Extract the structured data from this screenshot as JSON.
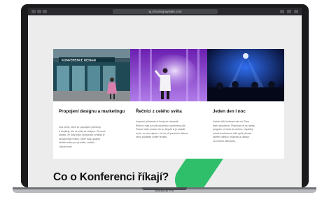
{
  "browser": {
    "url": "ig.choosegraywale.com"
  },
  "cards": [
    {
      "title": "Propojení designu a marketingu",
      "text": [
        "Dva světy, které se navzájem potřebují",
        "a doplňují, ale ne vždy se chápou. Chceme",
        "ukázat, že díky jejich spolupráci vznikají ty",
        "nejúčinnější řešení, které mají uplatnit",
        "skvělé místo pro produkt, značku",
        "i společnost."
      ],
      "image_sign": "KONFERENCE DESIGN"
    },
    {
      "title": "Řečníci z celého světa",
      "text": [
        "Inspirací přinesete si hosty ze zahraničí.",
        "Řečníci mají na své prezentaci vymezený čas.",
        "Potom máte prostor na to, abyste si je zeptali",
        "na to, co vás zajímá – ať už při panelové diskusi",
        "nebo podstatě coffee breaku."
      ]
    },
    {
      "title": "Jeden den i noc",
      "text": [
        "Každé dílčí hodinám vás do Zlína",
        "také nabudeme. Připravte se na nabitý",
        "program od rána do večera. Úspěšný",
        "ročník konference totiž opět přinese",
        "skvělé zážitky i inspiraci a zábavu",
        "na večerní afterparty."
      ]
    }
  ],
  "section": {
    "heading": "Co o Konferenci říkají?"
  },
  "device": {
    "label": "MacBook Pro"
  },
  "colors": {
    "accent_green": "#2fbf6b",
    "laptop_frame": "#1b1b1d",
    "screen_bg": "#ececec"
  }
}
